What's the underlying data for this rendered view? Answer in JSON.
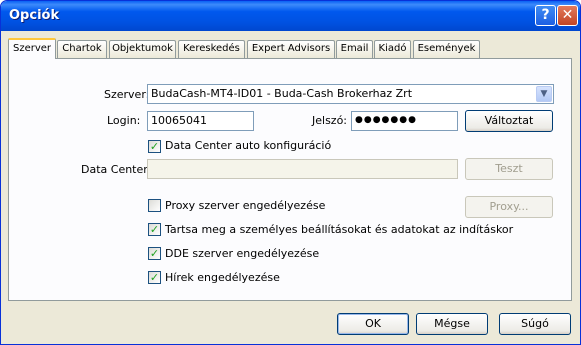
{
  "window": {
    "title": "Opciók",
    "help_glyph": "?",
    "close_glyph": "✕"
  },
  "tabs": [
    "Szerver",
    "Chartok",
    "Objektumok",
    "Kereskedés",
    "Expert Advisors",
    "Email",
    "Kiadó",
    "Események"
  ],
  "server": {
    "label": "Szerver:",
    "value": "BudaCash-MT4-ID01 - Buda-Cash Brokerhaz Zrt",
    "dropdown_glyph": "▼"
  },
  "login": {
    "label": "Login:",
    "value": "10065041"
  },
  "password": {
    "label": "Jelszó:",
    "value": "●●●●●●●"
  },
  "change_button": "Változtat",
  "datacenter_auto": {
    "label": "Data Center auto konfiguráció",
    "checked": true,
    "mark": "✓"
  },
  "datacenter": {
    "label": "Data Center:",
    "value": ""
  },
  "test_button": "Teszt",
  "proxy_enable": {
    "label": "Proxy szerver engedélyezése",
    "checked": false,
    "mark": ""
  },
  "proxy_button": "Proxy...",
  "keep_personal": {
    "label": "Tartsa meg a személyes beállításokat és adatokat az indításkor",
    "checked": true,
    "mark": "✓"
  },
  "dde_enable": {
    "label": "DDE szerver engedélyezése",
    "checked": true,
    "mark": "✓"
  },
  "news_enable": {
    "label": "Hírek engedélyezése",
    "checked": true,
    "mark": "✓"
  },
  "buttons": {
    "ok": "OK",
    "cancel": "Mégse",
    "help": "Súgó"
  }
}
